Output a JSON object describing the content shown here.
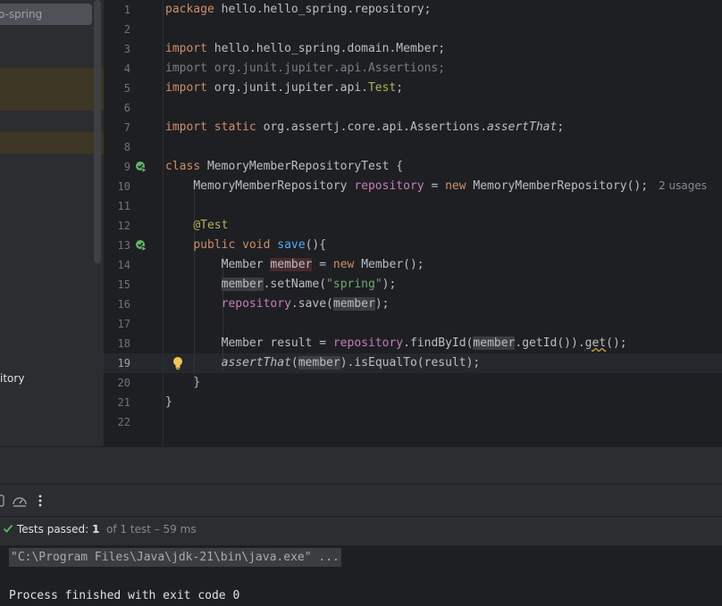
{
  "sidebar": {
    "search_text": "o-spring",
    "repo_item_label": "itory"
  },
  "editor": {
    "line_numbers": [
      "1",
      "2",
      "3",
      "4",
      "5",
      "6",
      "7",
      "8",
      "9",
      "10",
      "11",
      "12",
      "13",
      "14",
      "15",
      "16",
      "17",
      "18",
      "19",
      "20",
      "21",
      "22"
    ],
    "usages_hint": "2 usages",
    "tokens": {
      "package_kw": "package",
      "package_name": "hello.hello_spring.repository;",
      "import_kw": "import",
      "import1": "hello.hello_spring.domain.Member;",
      "import2": "import org.junit.jupiter.api.Assertions;",
      "import3_pre": "org.junit.jupiter.api.",
      "import3_cls": "Test",
      "static_kw": "static",
      "import4_pre": "org.assertj.core.api.Assertions.",
      "import4_fn": "assertThat",
      "class_kw": "class",
      "class_name": "MemoryMemberRepositoryTest {",
      "type_repo": "MemoryMemberRepository",
      "field_repo": "repository",
      "eq": "=",
      "new_kw": "new",
      "ctor_repo": "MemoryMemberRepository();",
      "annotation": "@Test",
      "public_kw": "public",
      "void_kw": "void",
      "method_save": "save",
      "method_save_tail": "(){",
      "type_member": "Member",
      "var_member": "member",
      "ctor_member": "Member();",
      "set_name": ".setName(",
      "str_spring": "\"spring\"",
      "paren_semi": ");",
      "save_call": ".save(",
      "var_result": "Member result",
      "find_by_id": ".findById(",
      "get_id": ".getId()).",
      "get_fn": "get",
      "get_tail": "();",
      "assert_fn": "assertThat",
      "open_paren": "(",
      "is_equal": ").isEqualTo(result);",
      "close_brace": "}"
    }
  },
  "test_status": {
    "label": "Tests passed:",
    "passed": "1",
    "detail": "of 1 test – 59 ms"
  },
  "console": {
    "command": "\"C:\\Program Files\\Java\\jdk-21\\bin\\java.exe\" ...",
    "exit_message": "Process finished with exit code 0"
  },
  "icons": {
    "run_gutter": "run-test-icon",
    "bulb": "lightbulb-icon",
    "check": "check-icon",
    "more": "more-vertical-icon"
  }
}
